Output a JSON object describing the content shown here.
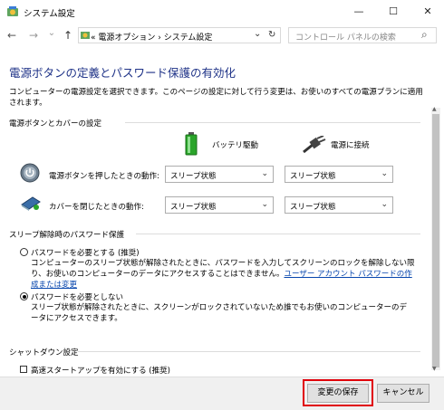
{
  "window": {
    "title": "システム設定",
    "minimize": "—",
    "maximize": "☐",
    "close": "✕"
  },
  "nav": {
    "back": "←",
    "forward": "→",
    "dropdown": "⌄",
    "up": "↑",
    "breadcrumb": "«  電源オプション  ›  システム設定",
    "addr_dropdown": "⌄",
    "refresh": "↻",
    "search_placeholder": "コントロール パネルの検索",
    "search_icon": "⌕"
  },
  "main": {
    "title": "電源ボタンの定義とパスワード保護の有効化",
    "description": "コンピューターの電源設定を選択できます。このページの設定に対して行う変更は、お使いのすべての電源プランに適用されます。"
  },
  "power_buttons": {
    "heading": "電源ボタンとカバーの設定",
    "col_battery": "バッテリ駆動",
    "col_plugged": "電源に接続",
    "rows": [
      {
        "label": "電源ボタンを押したときの動作:",
        "battery": "スリープ状態",
        "plugged": "スリープ状態"
      },
      {
        "label": "カバーを閉じたときの動作:",
        "battery": "スリープ状態",
        "plugged": "スリープ状態"
      }
    ]
  },
  "password": {
    "heading": "スリープ解除時のパスワード保護",
    "options": [
      {
        "label": "パスワードを必要とする (推奨)",
        "desc": "コンピューターのスリープ状態が解除されたときに、パスワードを入力してスクリーンのロックを解除しない限り、お使いのコンピューターのデータにアクセスすることはできません。",
        "link": "ユーザー アカウント パスワードの作成または変更",
        "selected": false
      },
      {
        "label": "パスワードを必要としない",
        "desc": "スリープ状態が解除されたときに、スクリーンがロックされていないため誰でもお使いのコンピューターのデータにアクセスできます。",
        "selected": true
      }
    ]
  },
  "shutdown": {
    "heading": "シャットダウン設定",
    "fast_startup": "高速スタートアップを有効にする (推奨)"
  },
  "footer": {
    "save": "変更の保存",
    "cancel": "キャンセル"
  },
  "colors": {
    "title": "#1e3287",
    "link": "#0645ad",
    "highlight": "#e0000b"
  }
}
